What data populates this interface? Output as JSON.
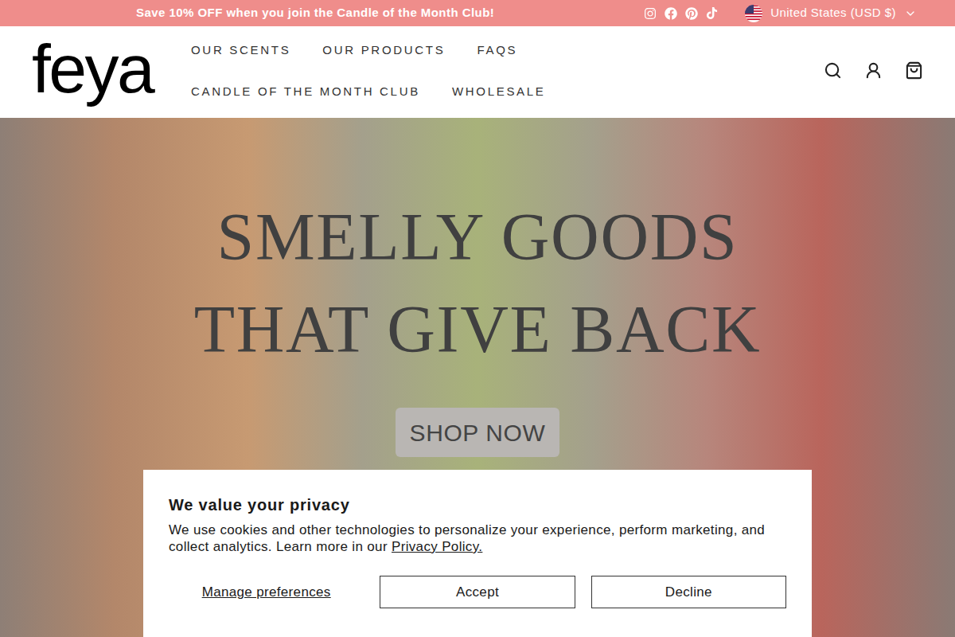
{
  "announcement": {
    "text": "Save 10% OFF when you join the Candle of the Month Club!"
  },
  "locale": {
    "label": "United States (USD $)"
  },
  "logo": {
    "text": "feya"
  },
  "nav": {
    "items": [
      {
        "label": "OUR SCENTS"
      },
      {
        "label": "OUR PRODUCTS"
      },
      {
        "label": "FAQS"
      },
      {
        "label": "CANDLE OF THE MONTH CLUB"
      },
      {
        "label": "WHOLESALE"
      }
    ]
  },
  "hero": {
    "heading_lines": [
      "SMELLY GOODS",
      "THAT GIVE BACK"
    ],
    "button": "SHOP NOW"
  },
  "cookie_banner": {
    "title": "We value your privacy",
    "body": "We use cookies and other technologies to personalize your experience, perform marketing, and collect analytics. Learn more in our ",
    "link": "Privacy Policy.",
    "manage": "Manage preferences",
    "buttons": [
      "Accept",
      "Decline"
    ]
  }
}
